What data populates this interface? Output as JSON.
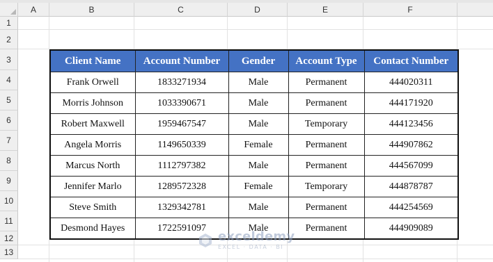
{
  "columns": [
    "A",
    "B",
    "C",
    "D",
    "E",
    "F"
  ],
  "rows": [
    "1",
    "2",
    "3",
    "4",
    "5",
    "6",
    "7",
    "8",
    "9",
    "10",
    "11",
    "12",
    "13"
  ],
  "table": {
    "headers": [
      "Client Name",
      "Account Number",
      "Gender",
      "Account Type",
      "Contact Number"
    ],
    "rows": [
      [
        "Frank Orwell",
        "1833271934",
        "Male",
        "Permanent",
        "444020311"
      ],
      [
        "Morris Johnson",
        "1033390671",
        "Male",
        "Permanent",
        "444171920"
      ],
      [
        "Robert Maxwell",
        "1959467547",
        "Male",
        "Temporary",
        "444123456"
      ],
      [
        "Angela Morris",
        "1149650339",
        "Female",
        "Permanent",
        "444907862"
      ],
      [
        "Marcus North",
        "1112797382",
        "Male",
        "Permanent",
        "444567099"
      ],
      [
        "Jennifer Marlo",
        "1289572328",
        "Female",
        "Temporary",
        "444878787"
      ],
      [
        "Steve Smith",
        "1329342781",
        "Male",
        "Permanent",
        "444254569"
      ],
      [
        "Desmond Hayes",
        "1722591097",
        "Male",
        "Permanent",
        "444909089"
      ]
    ]
  },
  "watermark": {
    "brand": "exceldemy",
    "tagline": "EXCEL · DATA · BI"
  },
  "colors": {
    "header_fill": "#4472c4",
    "header_text": "#ffffff",
    "sheet_header_bg": "#efefef"
  }
}
